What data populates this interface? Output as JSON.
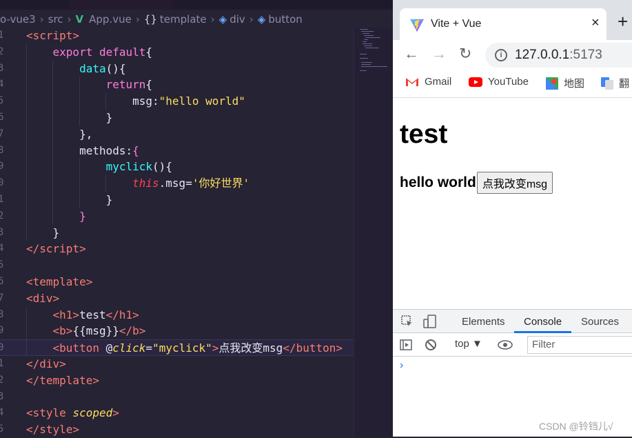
{
  "editor": {
    "breadcrumb": [
      "o-vue3",
      "src",
      "App.vue",
      "template",
      "div",
      "button"
    ],
    "lines": [
      {
        "n": "1",
        "html": "<span class='tg'>&lt;script&gt;</span>"
      },
      {
        "n": "2",
        "html": "    <span class='key'>export default</span><span class='pu'>{</span>"
      },
      {
        "n": "3",
        "html": "        <span class='fn'>data</span><span class='pu'>(){</span>"
      },
      {
        "n": "4",
        "html": "            <span class='key'>return</span><span class='pu'>{</span>"
      },
      {
        "n": "5",
        "html": "                <span class='pu'>msg:</span><span class='kw'>\"hello world\"</span>"
      },
      {
        "n": "6",
        "html": "            <span class='pu'>}</span>"
      },
      {
        "n": "7",
        "html": "        <span class='pu'>},</span>"
      },
      {
        "n": "8",
        "html": "        <span class='pu'>methods:</span><span class='key'>{</span>"
      },
      {
        "n": "9",
        "html": "            <span class='fn'>myclick</span><span class='pu'>(){</span>"
      },
      {
        "n": "0",
        "html": "                <span class='this'>this</span><span class='pu'>.msg=</span><span class='kw'>'你好世界'</span>"
      },
      {
        "n": "1",
        "html": "            <span class='pu'>}</span>"
      },
      {
        "n": "2",
        "html": "        <span class='key'>}</span>"
      },
      {
        "n": "3",
        "html": "    <span class='pu'>}</span>"
      },
      {
        "n": "4",
        "html": "<span class='tg'>&lt;/script&gt;</span>"
      },
      {
        "n": "5",
        "html": ""
      },
      {
        "n": "6",
        "html": "<span class='tg'>&lt;template&gt;</span>"
      },
      {
        "n": "7",
        "html": "<span class='tg'>&lt;div&gt;</span>"
      },
      {
        "n": "8",
        "html": "    <span class='tg'>&lt;h1&gt;</span><span class='pu'>test</span><span class='tg'>&lt;/h1&gt;</span>"
      },
      {
        "n": "9",
        "html": "    <span class='tg'>&lt;b&gt;</span><span class='pu'>{{msg}}</span><span class='tg'>&lt;/b&gt;</span>"
      },
      {
        "n": "0",
        "html": "    <span class='tg'>&lt;button</span> <span class='pu'>@</span><span class='attr'>click</span><span class='pu'>=</span><span class='kw'>\"myclick\"</span><span class='tg'>&gt;</span><span class='pu'>点我改变msg</span><span class='tg'>&lt;/button&gt;</span>"
      },
      {
        "n": "1",
        "html": "<span class='tg'>&lt;/div&gt;</span>"
      },
      {
        "n": "2",
        "html": "<span class='tg'>&lt;/template&gt;</span>"
      },
      {
        "n": "3",
        "html": ""
      },
      {
        "n": "4",
        "html": "<span class='tg'>&lt;style</span> <span class='attr'>scoped</span><span class='tg'>&gt;</span>"
      },
      {
        "n": "5",
        "html": "<span class='tg'>&lt;/style&gt;</span>"
      }
    ]
  },
  "browser": {
    "tab_title": "Vite + Vue",
    "tab_close": "×",
    "new_tab": "+",
    "url_host": "127.0.0.1",
    "url_port": ":5173",
    "bookmarks": [
      "Gmail",
      "YouTube",
      "地图",
      "翻"
    ],
    "page": {
      "heading": "test",
      "message": "hello world",
      "button_label": "点我改变msg"
    },
    "devtools": {
      "tabs": [
        "Elements",
        "Console",
        "Sources"
      ],
      "active_tab": "Console",
      "context": "top ▼",
      "filter_placeholder": "Filter",
      "prompt": "›"
    }
  },
  "watermark": "CSDN @铃铛儿√",
  "colors": {
    "editor_bg": "#262335",
    "vue_green": "#42b883",
    "chrome_blue": "#1a73e8"
  }
}
